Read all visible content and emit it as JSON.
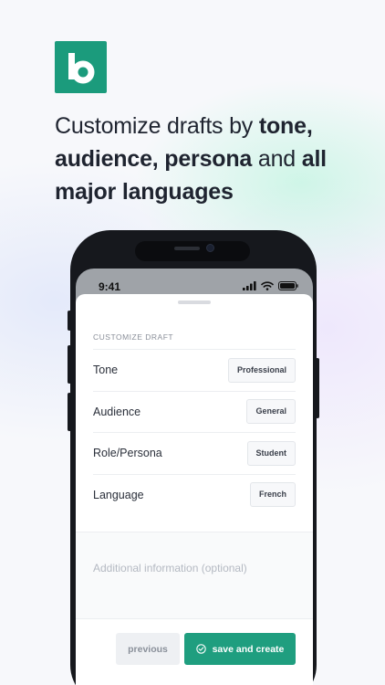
{
  "headline": {
    "part1": "Customize drafts by ",
    "bold1": "tone,",
    "part2": " ",
    "bold2": "audience, persona",
    "part3": " and ",
    "bold3": "all major languages"
  },
  "status_bar": {
    "time": "9:41"
  },
  "sheet": {
    "section_label": "CUSTOMIZE DRAFT",
    "rows": [
      {
        "label": "Tone",
        "value": "Professional"
      },
      {
        "label": "Audience",
        "value": "General"
      },
      {
        "label": "Role/Persona",
        "value": "Student"
      },
      {
        "label": "Language",
        "value": "French"
      }
    ],
    "additional_placeholder": "Additional information (optional)",
    "previous_label": "previous",
    "save_label": "save and create"
  },
  "colors": {
    "brand": "#1b9b7c",
    "save_button": "#1f9e7f",
    "text_dark": "#1f2430"
  },
  "icons": {
    "logo": "brand-b-logo",
    "signal": "cellular-signal-icon",
    "wifi": "wifi-icon",
    "battery": "battery-icon",
    "save": "check-circle-icon"
  }
}
